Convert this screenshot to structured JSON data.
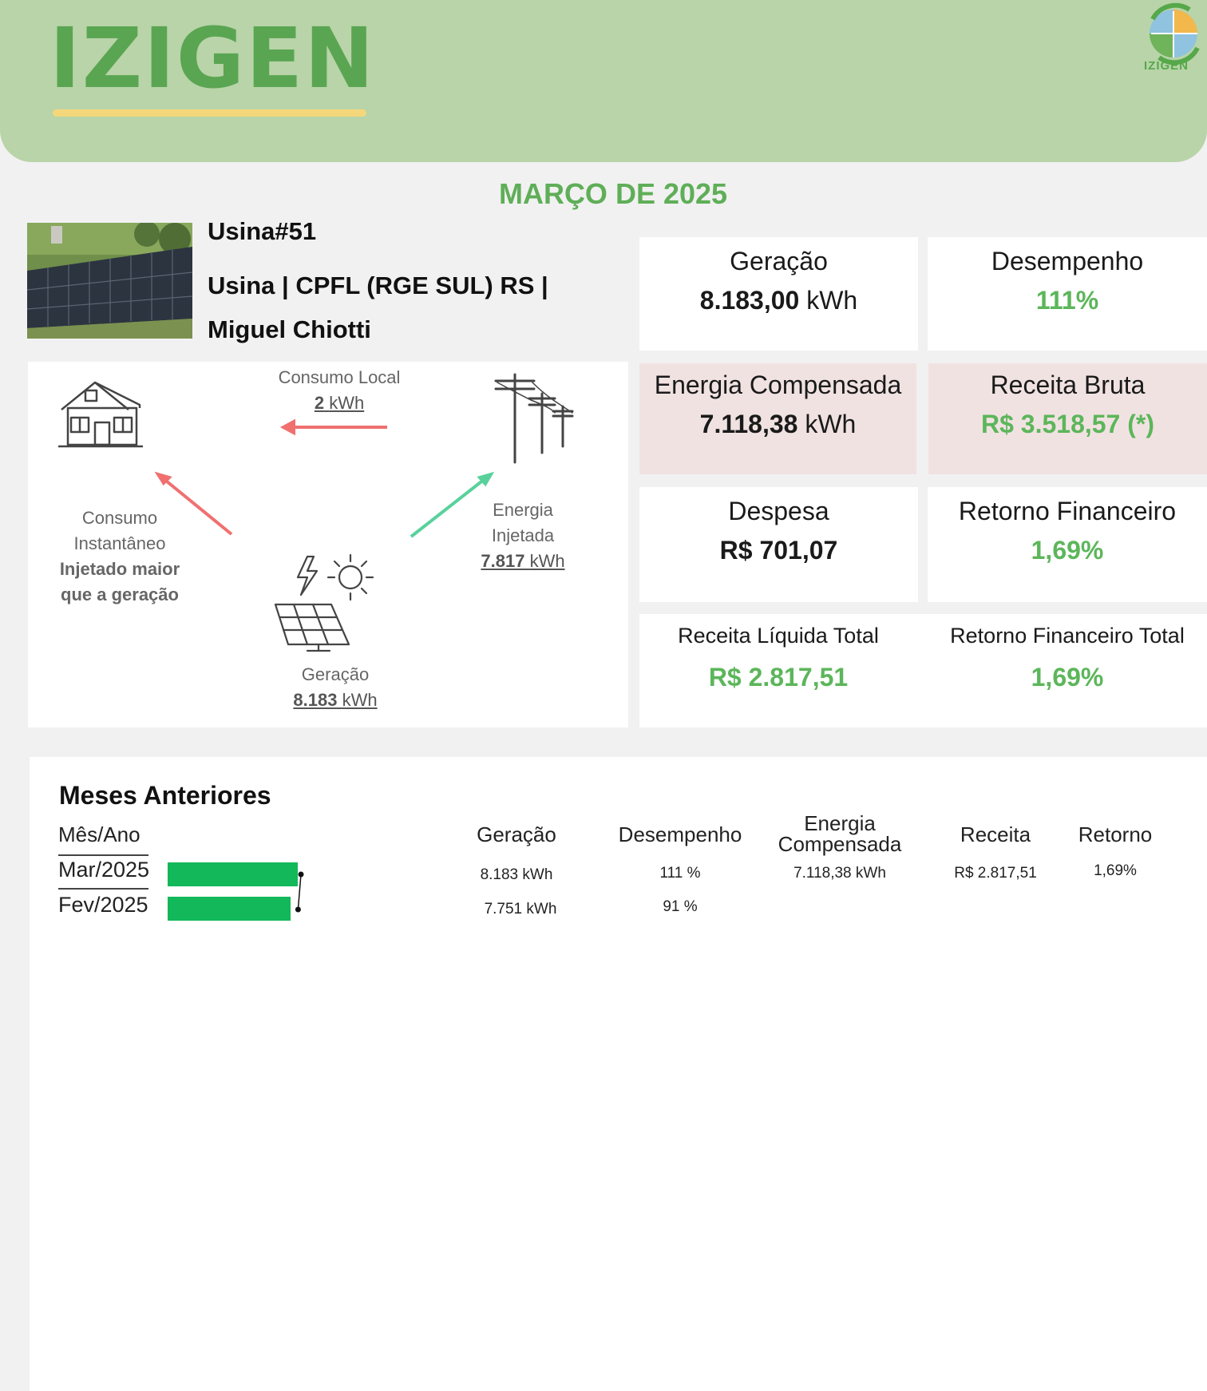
{
  "header": {
    "brand": "IZIGEN",
    "logo_text": "IZIGEN",
    "brand_color": "#5aa552",
    "accent_color": "#f4d77a"
  },
  "report": {
    "month_title": "MARÇO DE 2025",
    "plant_id": "Usina#51",
    "plant_name_line1": "Usina | CPFL (RGE SUL) RS |",
    "plant_name_line2": "Miguel Chiotti"
  },
  "cards": {
    "geracao": {
      "label": "Geração",
      "value": "8.183,00",
      "unit": "kWh"
    },
    "desempenho": {
      "label": "Desempenho",
      "value": "111%"
    },
    "energia_compensada": {
      "label": "Energia Compensada",
      "value": "7.118,38",
      "unit": "kWh"
    },
    "receita_bruta": {
      "label": "Receita Bruta",
      "value": "R$ 3.518,57 (*)"
    },
    "despesa": {
      "label": "Despesa",
      "value": "R$ 701,07"
    },
    "retorno_financeiro": {
      "label": "Retorno Financeiro",
      "value": "1,69%"
    },
    "receita_liquida_total": {
      "label": "Receita Líquida Total",
      "value": "R$ 2.817,51"
    },
    "retorno_financeiro_total": {
      "label": "Retorno Financeiro Total",
      "value": "1,69%"
    }
  },
  "flow": {
    "consumo_local_label": "Consumo Local",
    "consumo_local_value": "2",
    "consumo_inst_line1": "Consumo",
    "consumo_inst_line2": "Instantâneo",
    "consumo_inst_note_line1": "Injetado maior",
    "consumo_inst_note_line2": "que a geração",
    "energia_injetada_line1": "Energia",
    "energia_injetada_line2": "Injetada",
    "energia_injetada_value": "7.817",
    "geracao_label": "Geração",
    "geracao_value": "8.183",
    "unit": "kWh"
  },
  "history": {
    "title": "Meses Anteriores",
    "columns": {
      "mes_ano": "Mês/Ano",
      "geracao": "Geração",
      "desempenho": "Desempenho",
      "energia_line1": "Energia",
      "energia_line2": "Compensada",
      "receita": "Receita",
      "retorno": "Retorno"
    },
    "rows": [
      {
        "mes": "Mar/2025",
        "geracao": "8.183 kWh",
        "desempenho": "111 %",
        "energia": "7.118,38 kWh",
        "receita": "R$ 2.817,51",
        "retorno": "1,69%"
      },
      {
        "mes": "Fev/2025",
        "geracao": "7.751 kWh",
        "desempenho": "91 %",
        "energia": "",
        "receita": "",
        "retorno": ""
      }
    ]
  },
  "chart_data": {
    "type": "bar",
    "categories": [
      "Mar/2025",
      "Fev/2025"
    ],
    "values": [
      8183,
      7751
    ],
    "bar_color": "#12b85a"
  }
}
